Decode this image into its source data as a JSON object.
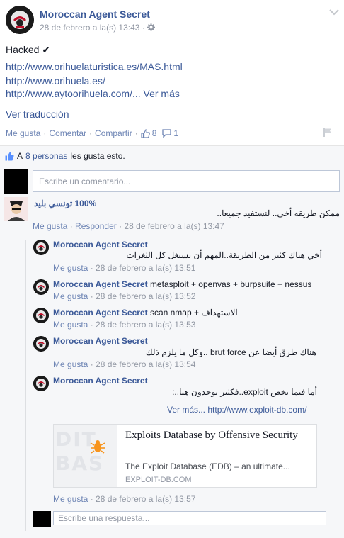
{
  "post": {
    "author": "Moroccan Agent Secret",
    "timestamp": "28 de febrero a la(s) 13:43",
    "separator": "·",
    "text": "Hacked ✔",
    "links": [
      "http://www.orihuelaturistica.es/MAS.html",
      "http://www.orihuela.es/",
      "http://www.aytoorihuela.com/..."
    ],
    "see_more": "Ver más",
    "translate": "Ver traducción",
    "actions": {
      "like": "Me gusta",
      "comment": "Comentar",
      "share": "Compartir",
      "like_count": "8",
      "comment_count": "1"
    }
  },
  "likes_summary": {
    "prefix": "A",
    "people": "8 personas",
    "suffix": "les gusta esto."
  },
  "comment_box": {
    "placeholder": "Escribe un comentario..."
  },
  "comment": {
    "author": "100% تونسي بليد",
    "text": "ممكن طريقه أخي.. لنستفيد جميعا..",
    "like": "Me gusta",
    "reply": "Responder",
    "timestamp": "28 de febrero a la(s) 13:47"
  },
  "replies": [
    {
      "author": "Moroccan Agent Secret",
      "text": "أخي هناك كثير من الطريقة..المهم أن تستغل كل الثغرات",
      "like": "Me gusta",
      "timestamp": "28 de febrero a la(s) 13:51"
    },
    {
      "author": "Moroccan Agent Secret",
      "text": "metasploit + openvas + burpsuite + nessus",
      "like": "Me gusta",
      "timestamp": "28 de febrero a la(s) 13:52"
    },
    {
      "author": "Moroccan Agent Secret",
      "text": "scan nmap + الاستهداف",
      "like": "Me gusta",
      "timestamp": "28 de febrero a la(s) 13:53"
    },
    {
      "author": "Moroccan Agent Secret",
      "text": "هناك طرق أيضا عن brut force ..وكل ما يلزم ذلك",
      "like": "Me gusta",
      "timestamp": "28 de febrero a la(s) 13:54"
    },
    {
      "author": "Moroccan Agent Secret",
      "text": "أما فيما يخص exploit..فكثير يوجدون هنا..:",
      "see_more": "Ver más...",
      "link": "http://www.exploit-db.com/",
      "like": "Me gusta",
      "timestamp": "28 de febrero a la(s) 13:57"
    }
  ],
  "link_card": {
    "title": "Exploits Database by Offensive Security",
    "description": "The Exploit Database (EDB) – an ultimate...",
    "domain": "EXPLOIT-DB.COM",
    "thumb_text": "DIT BAS"
  },
  "reply_box": {
    "placeholder": "Escribe una respuesta..."
  },
  "colors": {
    "link": "#3b5998",
    "meta": "#9197a3",
    "panel": "#f6f7f9"
  },
  "icons": [
    "settings-gear-icon",
    "chevron-down-icon",
    "thumbs-up-icon",
    "comment-bubble-icon",
    "flag-icon",
    "bug-icon"
  ]
}
